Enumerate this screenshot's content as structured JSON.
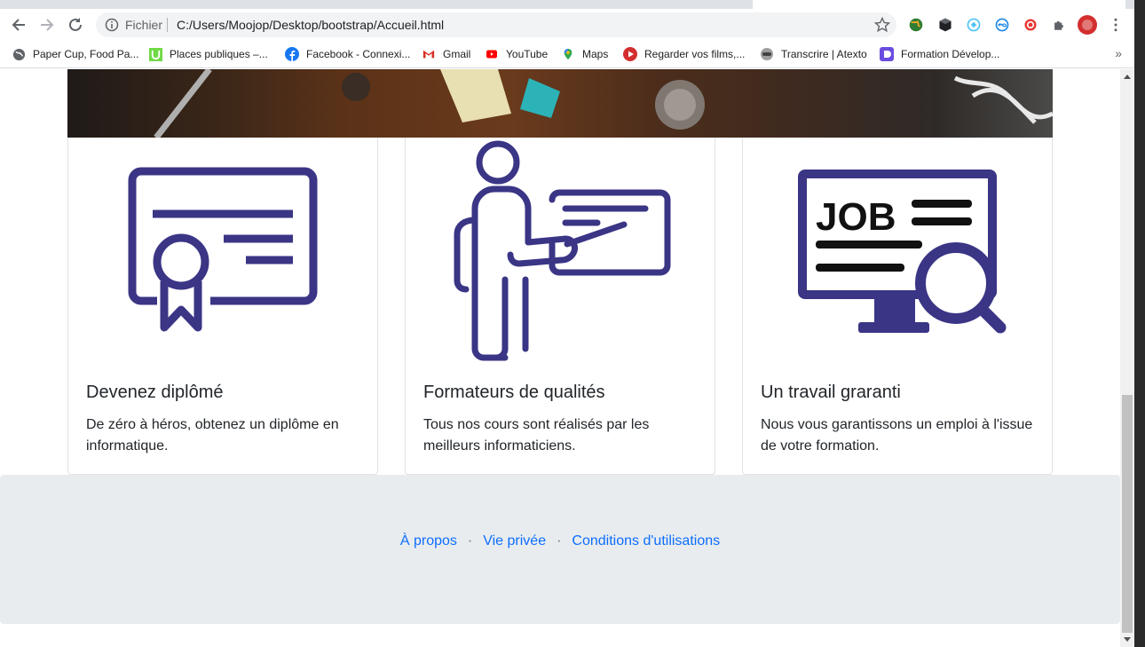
{
  "browser": {
    "scheme_label": "Fichier",
    "url": "C:/Users/Moojop/Desktop/bootstrap/Accueil.html",
    "bookmarks": [
      {
        "label": "Paper Cup, Food Pa...",
        "icon": "globe-icon"
      },
      {
        "label": "Places publiques –...",
        "icon": "upwork-icon"
      },
      {
        "label": "Facebook - Connexi...",
        "icon": "facebook-icon"
      },
      {
        "label": "Gmail",
        "icon": "gmail-icon"
      },
      {
        "label": "YouTube",
        "icon": "youtube-icon"
      },
      {
        "label": "Maps",
        "icon": "maps-pin-icon"
      },
      {
        "label": "Regarder vos films,...",
        "icon": "play-icon"
      },
      {
        "label": "Transcrire | Atexto",
        "icon": "atexto-icon"
      },
      {
        "label": "Formation Dévelop...",
        "icon": "formation-icon"
      }
    ],
    "bookmarks_more": "»"
  },
  "features": [
    {
      "title": "Devenez diplômé",
      "text": "De zéro à héros, obtenez un diplôme en informatique.",
      "icon": "diploma-icon"
    },
    {
      "title": "Formateurs de qualités",
      "text": "Tous nos cours sont réalisés par les meilleurs informaticiens.",
      "icon": "teacher-icon"
    },
    {
      "title": "Un travail graranti",
      "text": "Nous vous garantissons un emploi à l'issue de votre formation.",
      "icon": "job-search-icon"
    }
  ],
  "footer": {
    "links": [
      "À propos",
      "Vie privée",
      "Conditions d'utilisations"
    ],
    "separator": "·"
  },
  "colors": {
    "icon_primary": "#3a3585",
    "link": "#0d6efd",
    "footer_bg": "#e9ecef"
  }
}
